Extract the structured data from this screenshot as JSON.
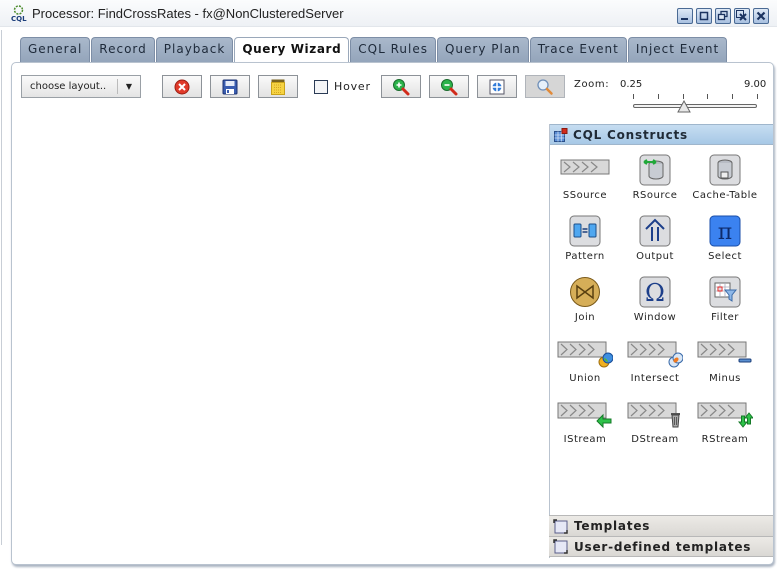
{
  "window": {
    "title": "Processor: FindCrossRates - fx@NonClusteredServer",
    "app_icon": "cql-icon",
    "controls": [
      "minimize",
      "maximize",
      "restore",
      "close-all",
      "close"
    ]
  },
  "tabs": [
    {
      "label": "General",
      "active": false
    },
    {
      "label": "Record",
      "active": false
    },
    {
      "label": "Playback",
      "active": false
    },
    {
      "label": "Query Wizard",
      "active": true
    },
    {
      "label": "CQL Rules",
      "active": false
    },
    {
      "label": "Query Plan",
      "active": false
    },
    {
      "label": "Trace Event",
      "active": false
    },
    {
      "label": "Inject Event",
      "active": false
    }
  ],
  "toolbar": {
    "layout_select": {
      "value": "choose layout..",
      "arrow": "▼"
    },
    "buttons": [
      {
        "name": "delete",
        "icon": "delete-icon"
      },
      {
        "name": "save",
        "icon": "save-icon"
      },
      {
        "name": "grid",
        "icon": "grid-icon"
      }
    ],
    "hover": {
      "label": "Hover",
      "checked": false
    },
    "zoom_buttons": [
      {
        "name": "zoom-in",
        "icon": "zoom-in-icon"
      },
      {
        "name": "zoom-out",
        "icon": "zoom-out-icon"
      },
      {
        "name": "fit",
        "icon": "fit-to-screen-icon"
      },
      {
        "name": "zoom-actual",
        "icon": "magnifier-icon",
        "pressed": true
      }
    ],
    "zoom": {
      "label": "Zoom:",
      "min_label": "0.25",
      "max_label": "9.00",
      "position_fraction": 0.41
    }
  },
  "palette": {
    "title": "CQL Constructs",
    "items": [
      {
        "label": "SSource",
        "icon": "stream-source-icon"
      },
      {
        "label": "RSource",
        "icon": "relation-source-icon"
      },
      {
        "label": "Cache-Table",
        "icon": "cache-table-icon"
      },
      {
        "label": "Pattern",
        "icon": "pattern-icon"
      },
      {
        "label": "Output",
        "icon": "output-icon"
      },
      {
        "label": "Select",
        "icon": "select-pi-icon"
      },
      {
        "label": "Join",
        "icon": "join-icon"
      },
      {
        "label": "Window",
        "icon": "window-omega-icon"
      },
      {
        "label": "Filter",
        "icon": "filter-icon"
      },
      {
        "label": "Union",
        "icon": "union-icon"
      },
      {
        "label": "Intersect",
        "icon": "intersect-icon"
      },
      {
        "label": "Minus",
        "icon": "minus-icon"
      },
      {
        "label": "IStream",
        "icon": "istream-icon"
      },
      {
        "label": "DStream",
        "icon": "dstream-icon"
      },
      {
        "label": "RStream",
        "icon": "rstream-icon"
      }
    ],
    "sections": [
      {
        "label": "Templates"
      },
      {
        "label": "User-defined templates"
      }
    ]
  },
  "colors": {
    "tab_inactive": "#9fb0c5",
    "palette_header": "#b6d2ec",
    "select_accent": "#2f6de0",
    "delete_red": "#e03a2a"
  }
}
